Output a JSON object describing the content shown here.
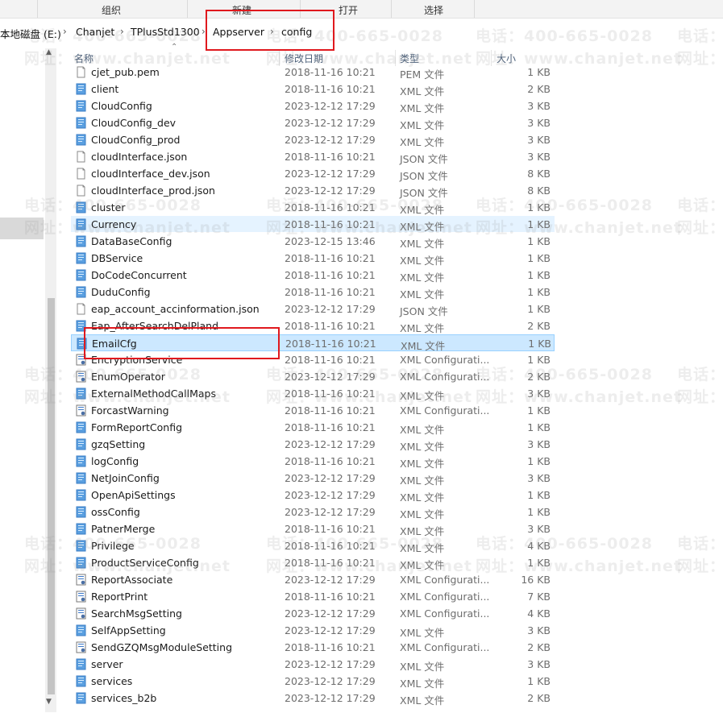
{
  "ribbon": {
    "groups": [
      "组织",
      "新建",
      "打开",
      "选择"
    ]
  },
  "breadcrumb": {
    "items": [
      "本地磁盘 (E:)",
      "Chanjet",
      "TPlusStd1300",
      "Appserver",
      "config"
    ],
    "separator": "›"
  },
  "columns": {
    "name": "名称",
    "date": "修改日期",
    "type": "类型",
    "size": "大小"
  },
  "scrollbar": {
    "up": "▲",
    "down": "▼"
  },
  "files": [
    {
      "name": "cjet_pub.pem",
      "date": "2018-11-16 10:21",
      "type": "PEM 文件",
      "size": "1 KB",
      "icon": "generic-file-icon"
    },
    {
      "name": "client",
      "date": "2018-11-16 10:21",
      "type": "XML 文件",
      "size": "2 KB",
      "icon": "xml-file-icon"
    },
    {
      "name": "CloudConfig",
      "date": "2023-12-12 17:29",
      "type": "XML 文件",
      "size": "3 KB",
      "icon": "xml-file-icon"
    },
    {
      "name": "CloudConfig_dev",
      "date": "2023-12-12 17:29",
      "type": "XML 文件",
      "size": "3 KB",
      "icon": "xml-file-icon"
    },
    {
      "name": "CloudConfig_prod",
      "date": "2023-12-12 17:29",
      "type": "XML 文件",
      "size": "3 KB",
      "icon": "xml-file-icon"
    },
    {
      "name": "cloudInterface.json",
      "date": "2018-11-16 10:21",
      "type": "JSON 文件",
      "size": "3 KB",
      "icon": "generic-file-icon"
    },
    {
      "name": "cloudInterface_dev.json",
      "date": "2023-12-12 17:29",
      "type": "JSON 文件",
      "size": "8 KB",
      "icon": "generic-file-icon"
    },
    {
      "name": "cloudInterface_prod.json",
      "date": "2023-12-12 17:29",
      "type": "JSON 文件",
      "size": "8 KB",
      "icon": "generic-file-icon"
    },
    {
      "name": "cluster",
      "date": "2018-11-16 10:21",
      "type": "XML 文件",
      "size": "1 KB",
      "icon": "xml-file-icon"
    },
    {
      "name": "Currency",
      "date": "2018-11-16 10:21",
      "type": "XML 文件",
      "size": "1 KB",
      "icon": "xml-file-icon"
    },
    {
      "name": "DataBaseConfig",
      "date": "2023-12-15 13:46",
      "type": "XML 文件",
      "size": "1 KB",
      "icon": "xml-file-icon"
    },
    {
      "name": "DBService",
      "date": "2018-11-16 10:21",
      "type": "XML 文件",
      "size": "1 KB",
      "icon": "xml-file-icon"
    },
    {
      "name": "DoCodeConcurrent",
      "date": "2018-11-16 10:21",
      "type": "XML 文件",
      "size": "1 KB",
      "icon": "xml-file-icon"
    },
    {
      "name": "DuduConfig",
      "date": "2018-11-16 10:21",
      "type": "XML 文件",
      "size": "1 KB",
      "icon": "xml-file-icon"
    },
    {
      "name": "eap_account_accinformation.json",
      "date": "2023-12-12 17:29",
      "type": "JSON 文件",
      "size": "1 KB",
      "icon": "generic-file-icon"
    },
    {
      "name": "Eap_AfterSearchDelPland",
      "date": "2018-11-16 10:21",
      "type": "XML 文件",
      "size": "2 KB",
      "icon": "xml-file-icon"
    },
    {
      "name": "EmailCfg",
      "date": "2018-11-16 10:21",
      "type": "XML 文件",
      "size": "1 KB",
      "icon": "xml-file-icon",
      "selected": true
    },
    {
      "name": "EncryptionService",
      "date": "2018-11-16 10:21",
      "type": "XML Configurati...",
      "size": "1 KB",
      "icon": "config-file-icon"
    },
    {
      "name": "EnumOperator",
      "date": "2023-12-12 17:29",
      "type": "XML Configurati...",
      "size": "2 KB",
      "icon": "config-file-icon"
    },
    {
      "name": "ExternalMethodCallMaps",
      "date": "2018-11-16 10:21",
      "type": "XML 文件",
      "size": "3 KB",
      "icon": "xml-file-icon"
    },
    {
      "name": "ForcastWarning",
      "date": "2018-11-16 10:21",
      "type": "XML Configurati...",
      "size": "1 KB",
      "icon": "config-file-icon"
    },
    {
      "name": "FormReportConfig",
      "date": "2018-11-16 10:21",
      "type": "XML 文件",
      "size": "1 KB",
      "icon": "xml-file-icon"
    },
    {
      "name": "gzqSetting",
      "date": "2023-12-12 17:29",
      "type": "XML 文件",
      "size": "3 KB",
      "icon": "xml-file-icon"
    },
    {
      "name": "logConfig",
      "date": "2018-11-16 10:21",
      "type": "XML 文件",
      "size": "1 KB",
      "icon": "xml-file-icon"
    },
    {
      "name": "NetJoinConfig",
      "date": "2023-12-12 17:29",
      "type": "XML 文件",
      "size": "3 KB",
      "icon": "xml-file-icon"
    },
    {
      "name": "OpenApiSettings",
      "date": "2023-12-12 17:29",
      "type": "XML 文件",
      "size": "1 KB",
      "icon": "xml-file-icon"
    },
    {
      "name": "ossConfig",
      "date": "2023-12-12 17:29",
      "type": "XML 文件",
      "size": "1 KB",
      "icon": "xml-file-icon"
    },
    {
      "name": "PatnerMerge",
      "date": "2018-11-16 10:21",
      "type": "XML 文件",
      "size": "3 KB",
      "icon": "xml-file-icon"
    },
    {
      "name": "Privilege",
      "date": "2018-11-16 10:21",
      "type": "XML 文件",
      "size": "4 KB",
      "icon": "xml-file-icon"
    },
    {
      "name": "ProductServiceConfig",
      "date": "2018-11-16 10:21",
      "type": "XML 文件",
      "size": "1 KB",
      "icon": "xml-file-icon"
    },
    {
      "name": "ReportAssociate",
      "date": "2023-12-12 17:29",
      "type": "XML Configurati...",
      "size": "16 KB",
      "icon": "config-file-icon"
    },
    {
      "name": "ReportPrint",
      "date": "2018-11-16 10:21",
      "type": "XML Configurati...",
      "size": "7 KB",
      "icon": "config-file-icon"
    },
    {
      "name": "SearchMsgSetting",
      "date": "2023-12-12 17:29",
      "type": "XML Configurati...",
      "size": "4 KB",
      "icon": "config-file-icon"
    },
    {
      "name": "SelfAppSetting",
      "date": "2023-12-12 17:29",
      "type": "XML 文件",
      "size": "3 KB",
      "icon": "xml-file-icon"
    },
    {
      "name": "SendGZQMsgModuleSetting",
      "date": "2018-11-16 10:21",
      "type": "XML Configurati...",
      "size": "2 KB",
      "icon": "config-file-icon"
    },
    {
      "name": "server",
      "date": "2023-12-12 17:29",
      "type": "XML 文件",
      "size": "3 KB",
      "icon": "xml-file-icon"
    },
    {
      "name": "services",
      "date": "2023-12-12 17:29",
      "type": "XML 文件",
      "size": "1 KB",
      "icon": "xml-file-icon"
    },
    {
      "name": "services_b2b",
      "date": "2023-12-12 17:29",
      "type": "XML 文件",
      "size": "2 KB",
      "icon": "xml-file-icon"
    }
  ],
  "watermark": {
    "phone": "电话：400-665-0028",
    "site": "网址：www.chanjet.net"
  },
  "colors": {
    "selection": "#cce8ff",
    "selection_border": "#99d1ff",
    "hover": "#e5f3ff",
    "annotation": "#e0191e",
    "xml_icon": "#4a90d9"
  }
}
